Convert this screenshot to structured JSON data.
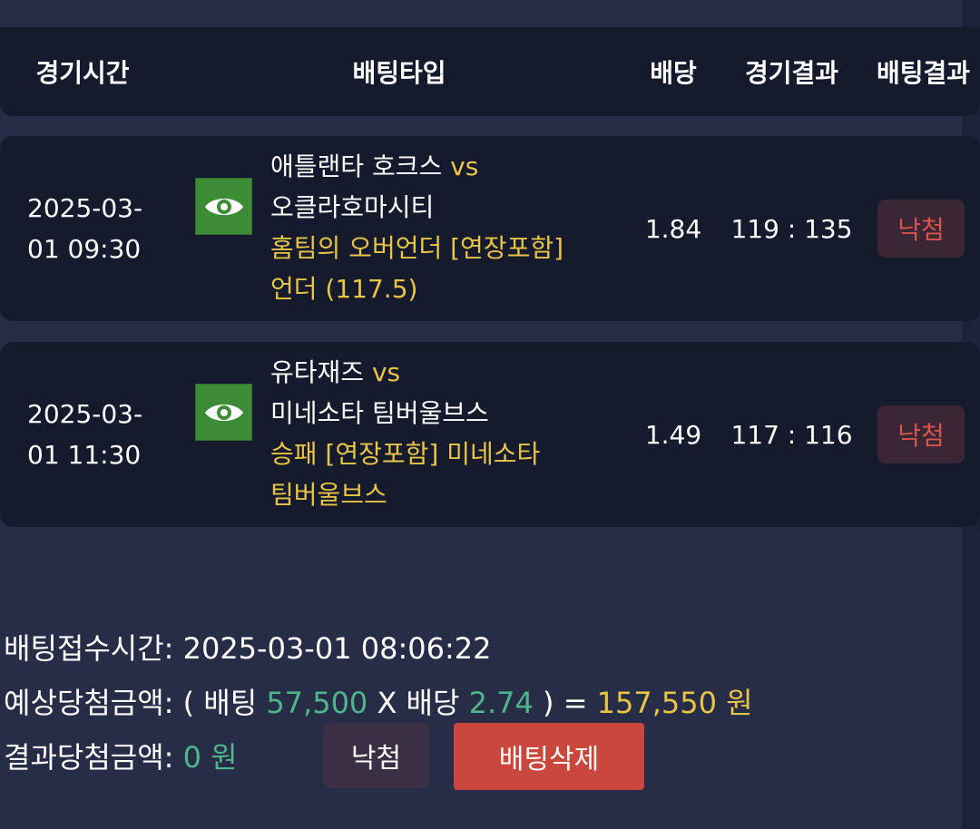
{
  "table": {
    "headers": {
      "time": "경기시간",
      "type": "배팅타입",
      "odds": "배당",
      "score": "경기결과",
      "result": "배팅결과"
    },
    "rows": [
      {
        "date": "2025-03-",
        "time": "01 09:30",
        "home": "애틀랜타 호크스",
        "vs": "vs",
        "away": "오클라호마시티",
        "market": "홈팀의 오버언더 [연장포함]",
        "pick": "언더 (117.5)",
        "odds": "1.84",
        "score": "119 : 135",
        "result": "낙첨"
      },
      {
        "date": "2025-03-",
        "time": "01 11:30",
        "home": "유타재즈",
        "vs": "vs",
        "away": "미네소타 팀버울브스",
        "market": "승패 [연장포함] 미네소타",
        "pick": "팀버울브스",
        "odds": "1.49",
        "score": "117 : 116",
        "result": "낙첨"
      }
    ]
  },
  "summary": {
    "receipt_label": "배팅접수시간:",
    "receipt_time": "2025-03-01 08:06:22",
    "expected_label": "예상당첨금액:",
    "open_paren": "(",
    "bet_label": "배팅",
    "bet_amount": "57,500",
    "times": "X",
    "odds_label": "배당",
    "total_odds": "2.74",
    "close_paren": ")",
    "equals": "=",
    "expected_amount": "157,550 원",
    "result_label": "결과당첨금액:",
    "result_amount": "0 원"
  },
  "buttons": {
    "lost": "낙첨",
    "delete": "배팅삭제"
  },
  "colors": {
    "background": "#272c47",
    "row": "#151a2c",
    "accent_yellow": "#e8c547",
    "accent_green": "#4fb58a",
    "lost_red": "#d9534f",
    "delete_button": "#c9473c",
    "eye_button": "#3d8b37"
  },
  "icons": {
    "view": "eye-icon"
  }
}
